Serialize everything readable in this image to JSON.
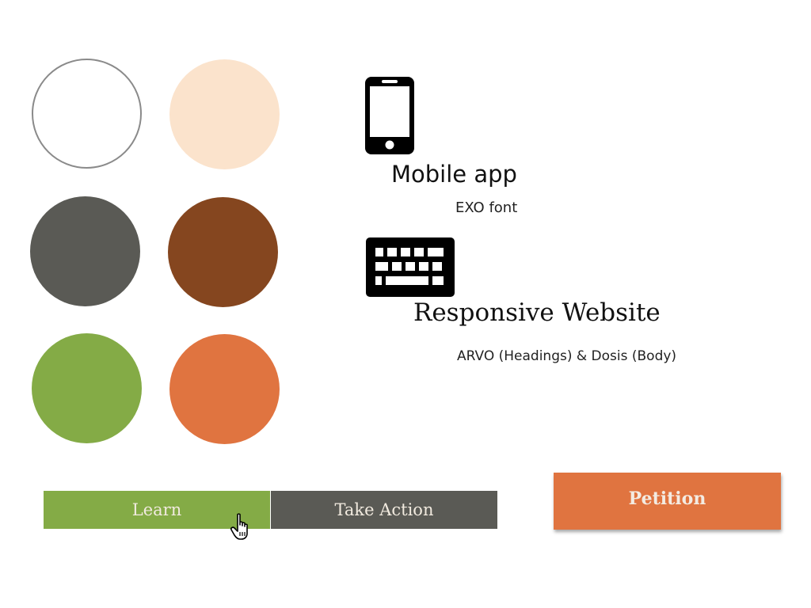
{
  "colors": {
    "white": "#ffffff",
    "cream": "#fbe3cc",
    "gray": "#5a5a55",
    "brown": "#85461f",
    "green": "#84ab46",
    "orange": "#e07440"
  },
  "swatches": [
    {
      "name": "white",
      "color": "#ffffff"
    },
    {
      "name": "cream",
      "color": "#fbe3cc"
    },
    {
      "name": "gray",
      "color": "#5a5a55"
    },
    {
      "name": "brown",
      "color": "#85461f"
    },
    {
      "name": "green",
      "color": "#84ab46"
    },
    {
      "name": "orange",
      "color": "#e07440"
    }
  ],
  "mobile": {
    "icon": "smartphone-icon",
    "title": "Mobile app",
    "subtitle": "EXO font"
  },
  "website": {
    "icon": "keyboard-icon",
    "title": "Responsive Website",
    "subtitle": "ARVO (Headings) & Dosis (Body)"
  },
  "buttons": {
    "learn": "Learn",
    "take_action": "Take Action",
    "petition": "Petition"
  },
  "cursor": {
    "icon": "hand-pointer-icon"
  }
}
